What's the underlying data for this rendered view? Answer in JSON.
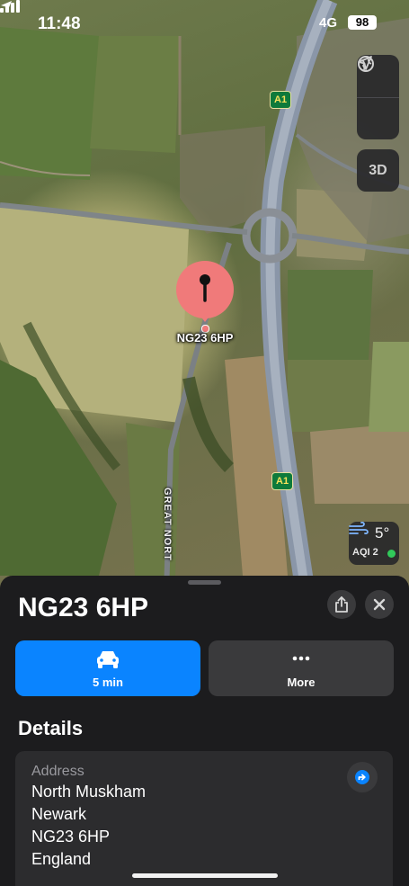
{
  "status_bar": {
    "time": "11:48",
    "network": "4G",
    "battery": "98"
  },
  "map": {
    "road_shield_top": "A1",
    "road_shield_bottom": "A1",
    "pin_label": "NG23 6HP",
    "street_label": "GREAT NORT",
    "controls": {
      "globe_icon": "globe-icon",
      "location_icon": "location-arrow-icon",
      "three_d_label": "3D"
    },
    "weather": {
      "temperature": "5°",
      "aqi": "AQI 2",
      "aqi_color": "#31c95a"
    }
  },
  "sheet": {
    "title": "NG23 6HP",
    "share_icon": "share-icon",
    "close_icon": "close-icon",
    "actions": [
      {
        "label": "5 min",
        "icon": "car-icon",
        "color": "#0a84ff"
      },
      {
        "label": "More",
        "icon": "ellipsis-icon",
        "color": "#3a3a3c"
      }
    ],
    "details_heading": "Details",
    "address": {
      "label": "Address",
      "lines": [
        "North Muskham",
        "Newark",
        "NG23 6HP",
        "England"
      ]
    }
  },
  "colors": {
    "accent": "#0a84ff",
    "pin": "#f07a7a",
    "road_shield": "#0e7a3b"
  }
}
